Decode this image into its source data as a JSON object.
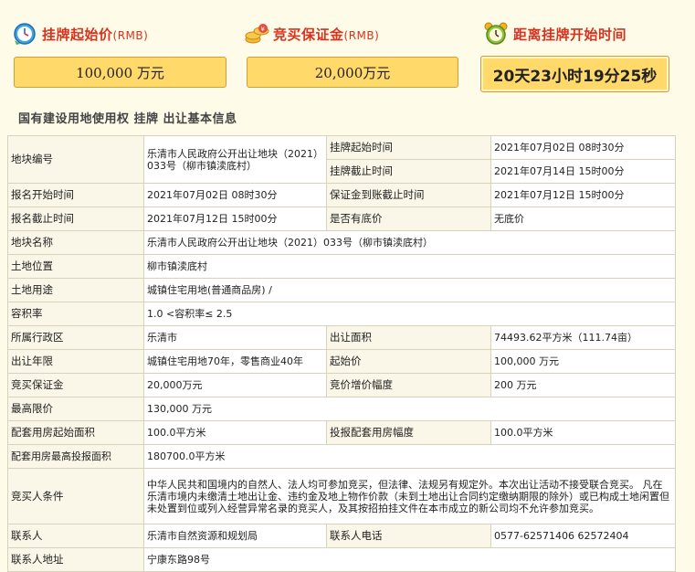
{
  "header": {
    "start_price": {
      "label": "挂牌起始价",
      "unit": "(RMB)",
      "value": "100,000  万元",
      "icon": "clock-icon"
    },
    "deposit": {
      "label": "竞买保证金",
      "unit": "(RMB)",
      "value": "20,000万元",
      "icon": "coins-icon"
    },
    "countdown": {
      "label": "距离挂牌开始时间",
      "value": "20天23小时19分25秒",
      "icon": "alarm-clock-icon"
    }
  },
  "section_title": "国有建设用地使用权 挂牌 出让基本信息",
  "info": {
    "plot_no_label": "地块编号",
    "plot_no": "乐清市人民政府公开出让地块（2021）033号（柳市镇渎底村）",
    "listing_start_label": "挂牌起始时间",
    "listing_start": "2021年07月02日 08时30分",
    "listing_end_label": "挂牌截止时间",
    "listing_end": "2021年07月14日 15时00分",
    "reg_start_label": "报名开始时间",
    "reg_start": "2021年07月02日 08时30分",
    "deposit_deadline_label": "保证金到账截止时间",
    "deposit_deadline": "2021年07月12日 15时00分",
    "reg_end_label": "报名截止时间",
    "reg_end": "2021年07月12日 15时00分",
    "reserve_label": "是否有底价",
    "reserve": "无底价",
    "plot_name_label": "地块名称",
    "plot_name": "乐清市人民政府公开出让地块（2021）033号（柳市镇渎底村）",
    "location_label": "土地位置",
    "location": "柳市镇渎底村",
    "usage_label": "土地用途",
    "usage": "城镇住宅用地(普通商品房) /",
    "far_label": "容积率",
    "far": "1.0 <容积率≤ 2.5",
    "district_label": "所属行政区",
    "district": "乐清市",
    "area_label": "出让面积",
    "area": "74493.62平方米（111.74亩）",
    "term_label": "出让年限",
    "term": "城镇住宅用地70年，零售商业40年",
    "start_price_label": "起始价",
    "start_price": "100,000  万元",
    "bid_deposit_label": "竞买保证金",
    "bid_deposit": "20,000万元",
    "increment_label": "竞价增价幅度",
    "increment": "200  万元",
    "max_price_label": "最高限价",
    "max_price": "130,000  万元",
    "housing_start_label": "配套用房起始面积",
    "housing_start": "100.0平方米",
    "housing_incr_label": "投报配套用房幅度",
    "housing_incr": "100.0平方米",
    "housing_max_label": "配套用房最高投报面积",
    "housing_max": "180700.0平方米",
    "bidder_cond_label": "竞买人条件",
    "bidder_cond": "中华人民共和国境内的自然人、法人均可参加竞买，但法律、法规另有规定外。本次出让活动不接受联合竞买。 凡在乐清市境内未缴清土地出让金、违约金及地上物作价款（未到土地出让合同约定缴纳期限的除外）或已构成土地闲置但未处置到位或列入经营异常名录的竞买人，及其按招拍挂文件在本市成立的新公司均不允许参加竞买。",
    "contact_label": "联系人",
    "contact": "乐清市自然资源和规划局",
    "phone_label": "联系人电话",
    "phone": "0577-62571406 62572404",
    "address_label": "联系人地址",
    "address": "宁康东路98号"
  },
  "colors": {
    "accent_red": "#d6331f",
    "box_fill": "#ffd96a",
    "page_bg": "#fffbe9"
  }
}
